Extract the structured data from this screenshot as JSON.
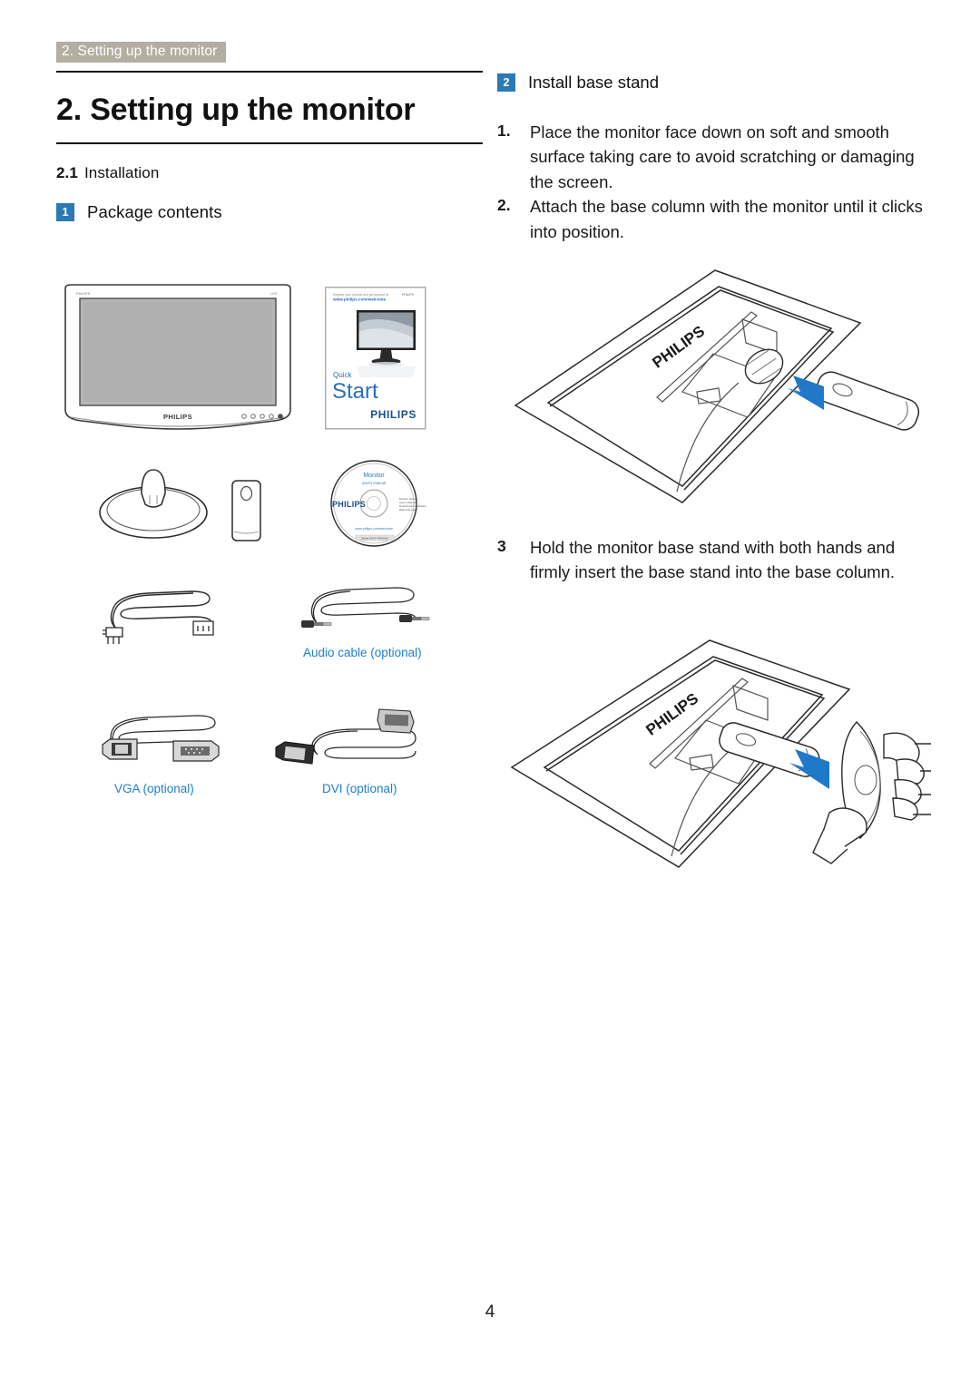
{
  "header": {
    "running_title": "2. Setting up the monitor"
  },
  "left_column": {
    "chapter_title": "2. Setting up the monitor",
    "section_number": "2.1",
    "section_title": "Installation",
    "subsection": {
      "badge": "1",
      "label": "Package contents"
    },
    "package_items": {
      "monitor_brand": "PHILIPS",
      "quick_start": {
        "line1": "Quick",
        "line2": "Start",
        "brand": "PHILIPS"
      },
      "cd": {
        "title": "Monitor",
        "subtitle": "user's manual",
        "brand": "PHILIPS"
      },
      "captions": {
        "audio_cable": "Audio cable (optional)",
        "vga_cable": "VGA (optional)",
        "dvi_cable": "DVI (optional)"
      }
    }
  },
  "right_column": {
    "badge": "2",
    "badge_label": "Install base stand",
    "steps": [
      {
        "marker": "1.",
        "text": "Place the monitor face down on soft and smooth surface taking care to avoid scratching or damaging the screen."
      },
      {
        "marker": "2.",
        "text": "Attach the base column with the monitor until it clicks into position."
      }
    ],
    "step_three": {
      "marker": "3",
      "text": "Hold the monitor base stand with both hands and firmly insert the base stand into the base column."
    },
    "illustration_brand": "PHILIPS"
  },
  "footer": {
    "page_number": "4"
  },
  "colors": {
    "accent_blue": "#2a7ab5",
    "caption_blue": "#1a7fd4",
    "header_badge_bg": "#b4ada1",
    "arrow_blue": "#1f79c8",
    "rule": "#111111"
  },
  "icons": {
    "header_badge": "running-header-badge",
    "number_badge": "number-badge"
  }
}
